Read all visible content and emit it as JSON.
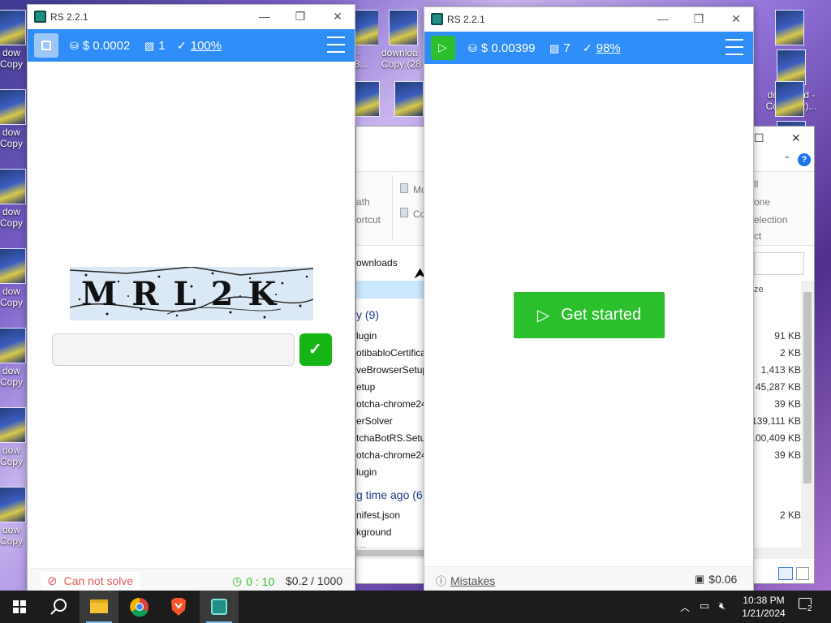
{
  "desktop": {
    "left_icons": [
      {
        "label": "dow\nCopy"
      },
      {
        "label": "dow\nCopy"
      },
      {
        "label": "dow\nCopy"
      },
      {
        "label": "dow\nCopy"
      },
      {
        "label": "dow\nCopy"
      },
      {
        "label": "dow\nCopy"
      },
      {
        "label": "dow\nCopy"
      }
    ],
    "mid_icons": [
      {
        "label": "downloa\nCopy (28"
      }
    ],
    "mid_left_label": "d - 48...",
    "right_icon": {
      "label": "download -\nCopy (72)..."
    }
  },
  "explorer": {
    "ribbon": {
      "path": "ath",
      "shortcut": "ortcut",
      "move": "Mo",
      "copy": "Co",
      "all": "ll",
      "none": "one",
      "selection": "election",
      "ct": "ct"
    },
    "address": "ownloads",
    "col_size": "ze",
    "group1": "y (9)",
    "group2": "g time ago (6",
    "files": [
      {
        "name": "lugin",
        "size": "91 KB"
      },
      {
        "name": "otibabloCertificat",
        "size": "2 KB"
      },
      {
        "name": "veBrowserSetup-",
        "size": "1,413 KB"
      },
      {
        "name": "etup",
        "size": "45,287 KB"
      },
      {
        "name": "otcha-chrome24",
        "size": "39 KB"
      },
      {
        "name": "erSolver",
        "size": "139,111 KB"
      },
      {
        "name": "tchaBotRS.Setup",
        "size": "100,409 KB"
      },
      {
        "name": "otcha-chrome24",
        "size": "39 KB"
      },
      {
        "name": "lugin",
        "size": ""
      }
    ],
    "files2": [
      {
        "name": "nifest.json",
        "size": "2 KB"
      },
      {
        "name": "kground",
        "size": ""
      },
      {
        "name": "up",
        "size": ""
      }
    ]
  },
  "rs_left": {
    "title": "RS 2.2.1",
    "balance": "$ 0.0002",
    "tasks": "1",
    "accuracy": "100%",
    "captcha_text": "MRL2K",
    "input_placeholder": "",
    "cannot_solve": "Can not solve",
    "timer": "0 : 10",
    "rate": "$0.2 / 1000"
  },
  "rs_right": {
    "title": "RS 2.2.1",
    "balance": "$ 0.00399",
    "tasks": "7",
    "accuracy": "98%",
    "get_started": "Get started",
    "mistakes": "Mistakes",
    "wallet": "$0.06"
  },
  "taskbar": {
    "time": "10:38 PM",
    "date": "1/21/2024",
    "notifications": "2"
  },
  "colors": {
    "toolbar_blue": "#2f8df7",
    "green": "#2bbf2b",
    "red": "#e05a5a"
  }
}
